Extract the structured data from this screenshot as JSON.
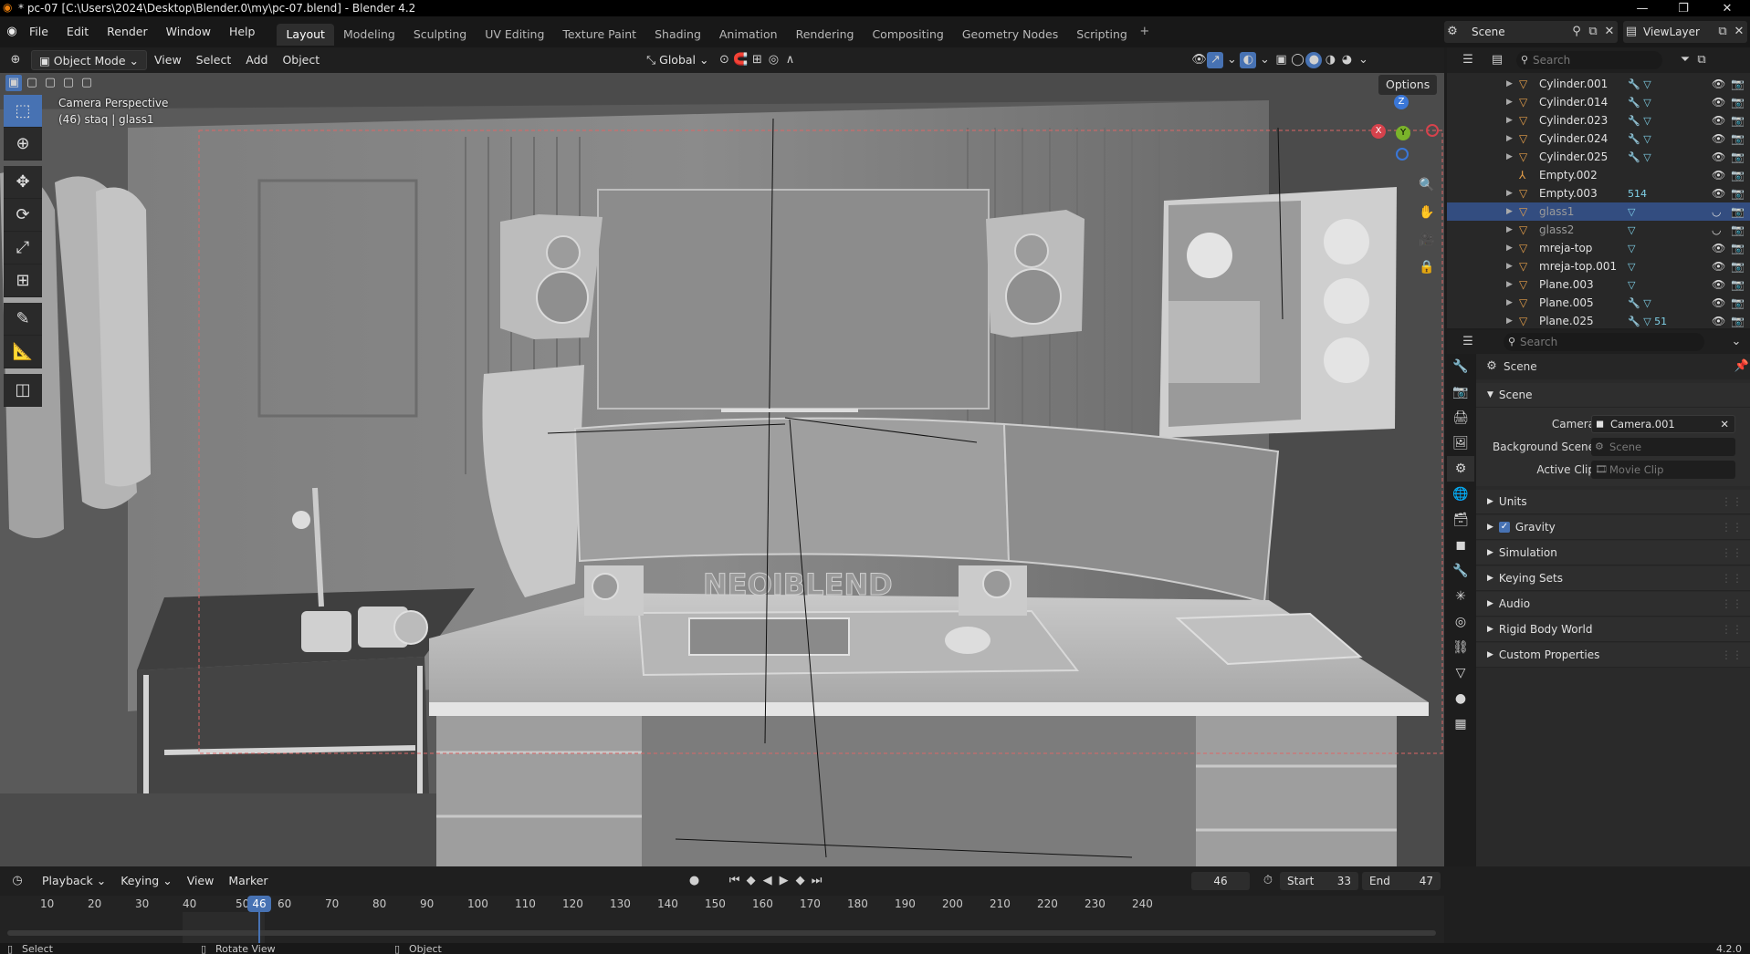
{
  "window": {
    "title": "* pc-07 [C:\\Users\\2024\\Desktop\\Blender.0\\my\\pc-07.blend] - Blender 4.2"
  },
  "menubar": {
    "menus": [
      "File",
      "Edit",
      "Render",
      "Window",
      "Help"
    ],
    "workspaces": [
      "Layout",
      "Modeling",
      "Sculpting",
      "UV Editing",
      "Texture Paint",
      "Shading",
      "Animation",
      "Rendering",
      "Compositing",
      "Geometry Nodes",
      "Scripting"
    ],
    "active_workspace": "Layout",
    "scene": "Scene",
    "view_layer": "ViewLayer"
  },
  "viewport_header": {
    "mode": "Object Mode",
    "menus": [
      "View",
      "Select",
      "Add",
      "Object"
    ],
    "transform_orientation": "Global",
    "options": "Options"
  },
  "viewport": {
    "camera_label": "Camera Perspective",
    "object_label": "(46) staq | glass1",
    "watermark": "NEOIBLEND"
  },
  "gizmo": {
    "z": "Z",
    "y": "Y",
    "x": "X"
  },
  "outliner": {
    "search_placeholder": "Search",
    "items": [
      {
        "name": "Cylinder.001",
        "mods": "🔧 ▽",
        "selected": false,
        "type": "mesh"
      },
      {
        "name": "Cylinder.014",
        "mods": "🔧 ▽",
        "selected": false,
        "type": "mesh"
      },
      {
        "name": "Cylinder.023",
        "mods": "🔧 ▽",
        "selected": false,
        "type": "mesh"
      },
      {
        "name": "Cylinder.024",
        "mods": "🔧 ▽",
        "selected": false,
        "type": "mesh"
      },
      {
        "name": "Cylinder.025",
        "mods": "🔧 ▽",
        "selected": false,
        "type": "mesh"
      },
      {
        "name": "Empty.002",
        "mods": "",
        "selected": false,
        "type": "empty"
      },
      {
        "name": "Empty.003",
        "mods": "514",
        "selected": false,
        "type": "mesh"
      },
      {
        "name": "glass1",
        "mods": "▽",
        "selected": true,
        "type": "mesh"
      },
      {
        "name": "glass2",
        "mods": "▽",
        "selected": false,
        "type": "mesh"
      },
      {
        "name": "mreja-top",
        "mods": "▽",
        "selected": false,
        "type": "mesh"
      },
      {
        "name": "mreja-top.001",
        "mods": "▽",
        "selected": false,
        "type": "mesh"
      },
      {
        "name": "Plane.003",
        "mods": "▽",
        "selected": false,
        "type": "mesh"
      },
      {
        "name": "Plane.005",
        "mods": "🔧 ▽",
        "selected": false,
        "type": "mesh"
      },
      {
        "name": "Plane.025",
        "mods": "🔧 ▽ 51",
        "selected": false,
        "type": "mesh"
      }
    ]
  },
  "properties": {
    "search_placeholder": "Search",
    "context": "Scene",
    "scene_panel": "Scene",
    "camera_label": "Camera",
    "camera_value": "Camera.001",
    "bg_scene_label": "Background Scene",
    "bg_scene_value": "Scene",
    "active_clip_label": "Active Clip",
    "active_clip_value": "Movie Clip",
    "sections": [
      "Units",
      "Gravity",
      "Simulation",
      "Keying Sets",
      "Audio",
      "Rigid Body World",
      "Custom Properties"
    ]
  },
  "timeline": {
    "menus": [
      "Playback",
      "Keying",
      "View",
      "Marker"
    ],
    "current_frame": "46",
    "start_label": "Start",
    "start": "33",
    "end_label": "End",
    "end": "47",
    "ticks": [
      "10",
      "20",
      "30",
      "40",
      "50",
      "60",
      "70",
      "80",
      "90",
      "100",
      "110",
      "120",
      "130",
      "140",
      "150",
      "160",
      "170",
      "180",
      "190",
      "200",
      "210",
      "220",
      "230",
      "240"
    ]
  },
  "statusbar": {
    "select": "Select",
    "rotate": "Rotate View",
    "object": "Object",
    "version": "4.2.0"
  }
}
